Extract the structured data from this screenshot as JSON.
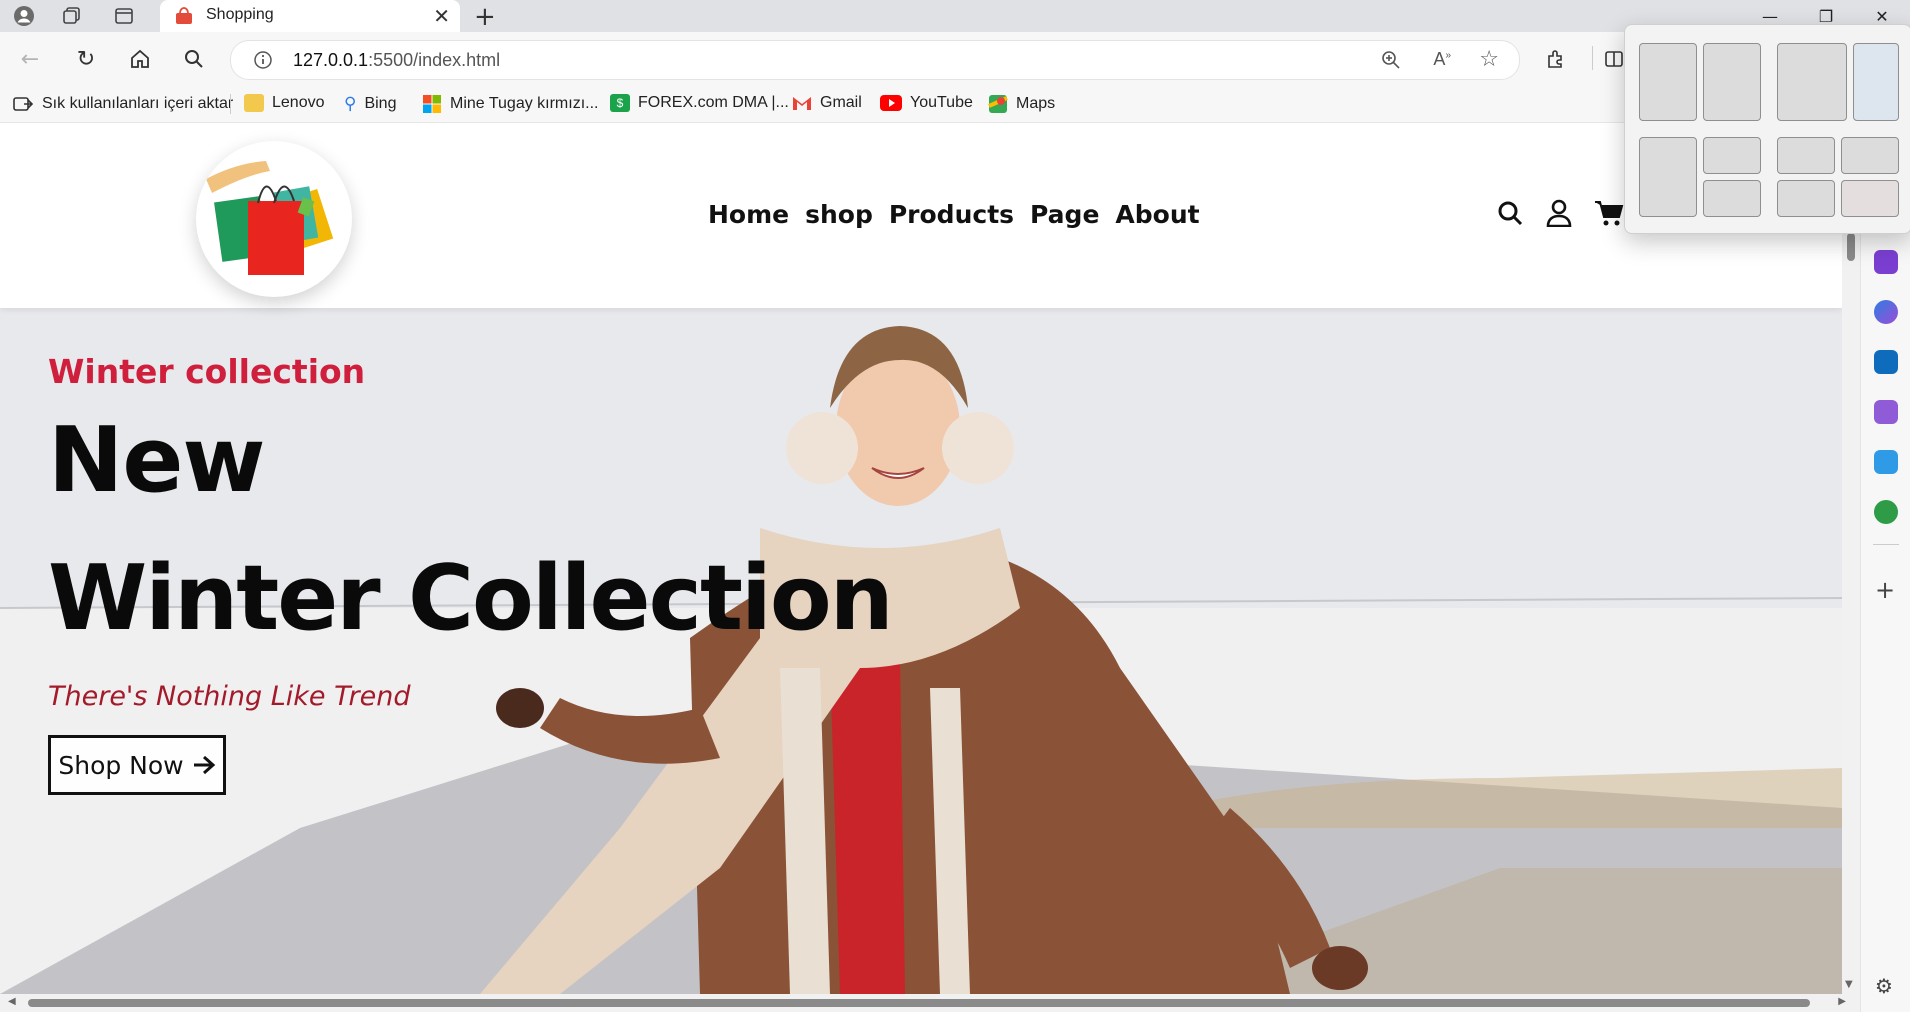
{
  "browser": {
    "tab_title": "Shopping",
    "url_prefix": "127.0.0.1",
    "url_rest": ":5500/index.html"
  },
  "bookmarks": {
    "import_label": "Sık kullanılanları içeri aktar",
    "items": [
      {
        "label": "Lenovo",
        "icon": "folder-icon",
        "color": "#f2c94c"
      },
      {
        "label": "Bing",
        "icon": "bing-search-icon",
        "color": "#2c7be5"
      },
      {
        "label": "Mine Tugay kırmızı...",
        "icon": "microsoft-icon",
        "color": "#f25022"
      },
      {
        "label": "FOREX.com DMA |...",
        "icon": "forex-icon",
        "color": "#1aa34a"
      },
      {
        "label": "Gmail",
        "icon": "gmail-icon",
        "color": "#ea4335"
      },
      {
        "label": "YouTube",
        "icon": "youtube-icon",
        "color": "#ff0000"
      },
      {
        "label": "Maps",
        "icon": "maps-icon",
        "color": "#34a853"
      }
    ]
  },
  "site": {
    "nav": [
      "Home",
      "shop",
      "Products",
      "Page",
      "About"
    ],
    "hero": {
      "eyebrow": "Winter collection",
      "headline_line1": "New",
      "headline_line2": "Winter Collection",
      "tagline": "There's Nothing Like Trend",
      "cta": "Shop Now"
    }
  },
  "colors": {
    "accent_red": "#cf1f3d",
    "tagline_red": "#a31b2a",
    "text_dark": "#0a0a0a"
  }
}
